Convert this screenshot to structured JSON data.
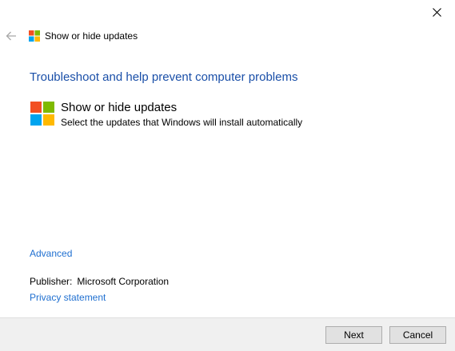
{
  "window": {
    "title": "Show or hide updates",
    "close_icon": "close-icon",
    "back_icon": "back-arrow-icon"
  },
  "main": {
    "heading": "Troubleshoot and help prevent computer problems",
    "tool": {
      "title": "Show or hide updates",
      "description": "Select the updates that Windows will install automatically",
      "icon": "windows-logo-icon"
    },
    "advanced_link": "Advanced",
    "publisher_label": "Publisher:",
    "publisher_value": "Microsoft Corporation",
    "privacy_link": "Privacy statement"
  },
  "footer": {
    "next_label": "Next",
    "cancel_label": "Cancel"
  },
  "colors": {
    "heading": "#1a4fa8",
    "link": "#1f6fd0",
    "logo_red": "#f25022",
    "logo_green": "#7fba00",
    "logo_blue": "#00a4ef",
    "logo_yellow": "#ffb900"
  }
}
